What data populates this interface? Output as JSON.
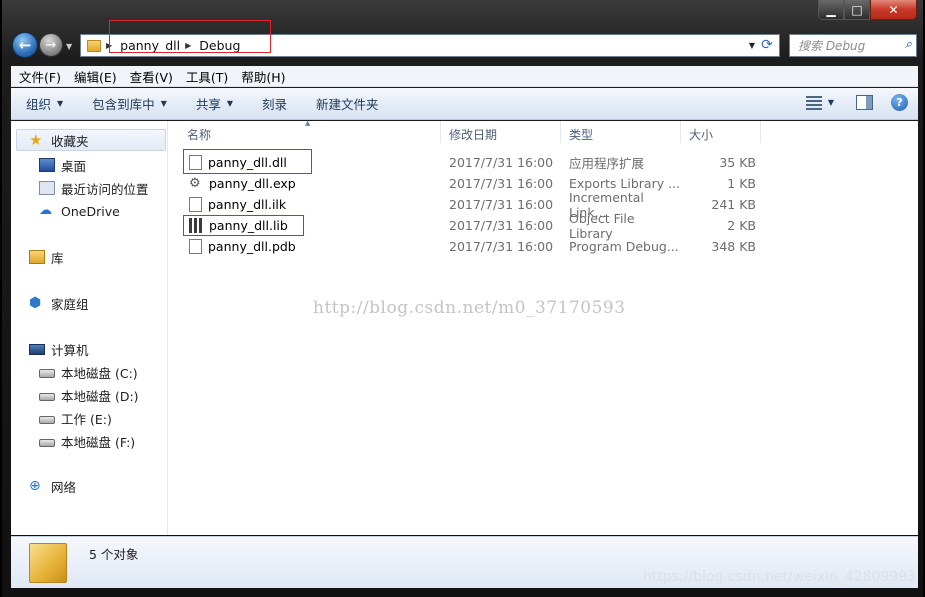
{
  "address": {
    "crumbs": [
      "panny_dll",
      "Debug"
    ]
  },
  "search": {
    "placeholder": "搜索 Debug"
  },
  "menu": [
    "文件(F)",
    "编辑(E)",
    "查看(V)",
    "工具(T)",
    "帮助(H)"
  ],
  "commands": {
    "organize": "组织",
    "include_in_library": "包含到库中",
    "share": "共享",
    "burn": "刻录",
    "new_folder": "新建文件夹"
  },
  "nav": {
    "favorites": "收藏夹",
    "desktop": "桌面",
    "recent": "最近访问的位置",
    "onedrive": "OneDrive",
    "libraries": "库",
    "homegroup": "家庭组",
    "computer": "计算机",
    "drive_c": "本地磁盘 (C:)",
    "drive_d": "本地磁盘 (D:)",
    "drive_e": "工作 (E:)",
    "drive_f": "本地磁盘 (F:)",
    "network": "网络"
  },
  "columns": {
    "name": "名称",
    "date": "修改日期",
    "type": "类型",
    "size": "大小"
  },
  "files": [
    {
      "name": "panny_dll.dll",
      "date": "2017/7/31 16:00",
      "type": "应用程序扩展",
      "size": "35 KB",
      "icon": "dll-file-icon"
    },
    {
      "name": "panny_dll.exp",
      "date": "2017/7/31 16:00",
      "type": "Exports Library ...",
      "size": "1 KB",
      "icon": "exp-file-icon"
    },
    {
      "name": "panny_dll.ilk",
      "date": "2017/7/31 16:00",
      "type": "Incremental Link...",
      "size": "241 KB",
      "icon": "ilk-file-icon"
    },
    {
      "name": "panny_dll.lib",
      "date": "2017/7/31 16:00",
      "type": "Object File Library",
      "size": "2 KB",
      "icon": "lib-file-icon"
    },
    {
      "name": "panny_dll.pdb",
      "date": "2017/7/31 16:00",
      "type": "Program Debug...",
      "size": "348 KB",
      "icon": "pdb-file-icon"
    }
  ],
  "watermark": "http://blog.csdn.net/m0_37170593",
  "status": {
    "count": "5 个对象"
  },
  "bottom_watermark": "https://blog.csdn.net/weixin_42809993",
  "colors": {
    "highlight_box": "#e0242d",
    "close_button": "#c8392a"
  }
}
